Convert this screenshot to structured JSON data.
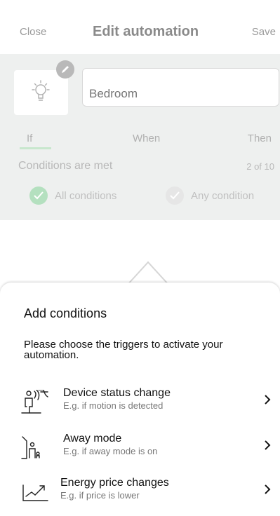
{
  "header": {
    "close_label": "Close",
    "title": "Edit automation",
    "save_label": "Save"
  },
  "automation": {
    "name_placeholder": "Bedroom"
  },
  "tabs": [
    {
      "label": "If"
    },
    {
      "label": "When"
    },
    {
      "label": "Then"
    }
  ],
  "conditions": {
    "label": "Conditions are met",
    "count": "2 of 10",
    "options": [
      {
        "label": "All conditions"
      },
      {
        "label": "Any condition"
      }
    ]
  },
  "sheet": {
    "title": "Add conditions",
    "description": "Please choose the triggers to activate your automation.",
    "items": [
      {
        "title": "Device status change",
        "subtitle": "E.g. if motion is detected",
        "icon": "motion-sensor-icon"
      },
      {
        "title": "Away mode",
        "subtitle": "E.g. if away mode is on",
        "icon": "away-mode-icon"
      },
      {
        "title": "Energy price changes",
        "subtitle": "E.g. if price is lower",
        "icon": "energy-price-icon"
      }
    ]
  },
  "colors": {
    "accent_green": "#b4e0bf",
    "sheet_bg": "#ffffff",
    "card_bg": "#eef0ef"
  }
}
